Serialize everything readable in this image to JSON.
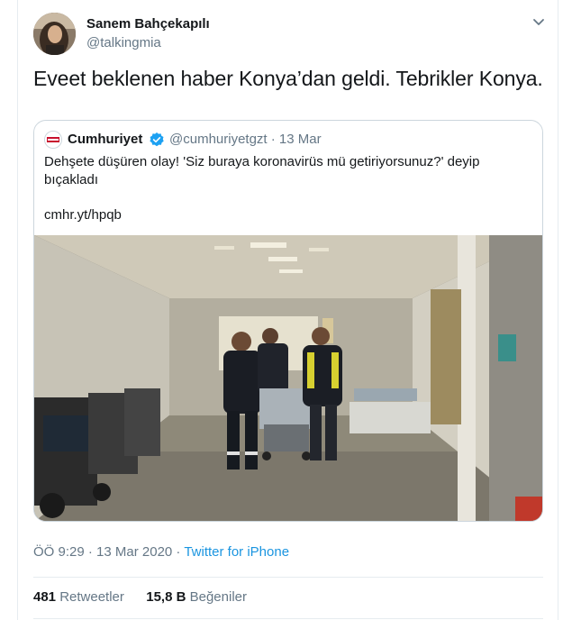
{
  "tweet": {
    "display_name": "Sanem Bahçekapılı",
    "handle": "@talkingmia",
    "text": "Eveet beklenen haber Konya’dan geldi. Tebrikler Konya.",
    "timestamp": "ÖÖ 9:29 · 13 Mar 2020 · ",
    "source": "Twitter for iPhone",
    "retweets_count": "481",
    "retweets_label": " Retweetler",
    "likes_count": "15,8 B",
    "likes_label": " Beğeniler",
    "menu_icon": "chevron-down-icon"
  },
  "quote": {
    "display_name": "Cumhuriyet",
    "verified_icon": "verified-badge-icon",
    "meta": "@cumhuriyetgzt · 13 Mar",
    "text": "Dehşete düşüren olay! 'Siz buraya koronavirüs mü getiriyorsunuz?' deyip bıçakladı",
    "link": "cmhr.yt/hpqb",
    "avatar_logo": "Cumhuriyet"
  },
  "colors": {
    "accent": "#1b95e0",
    "verified": "#1da1f2",
    "secondary_text": "#657786",
    "border": "#ccd6dd"
  }
}
